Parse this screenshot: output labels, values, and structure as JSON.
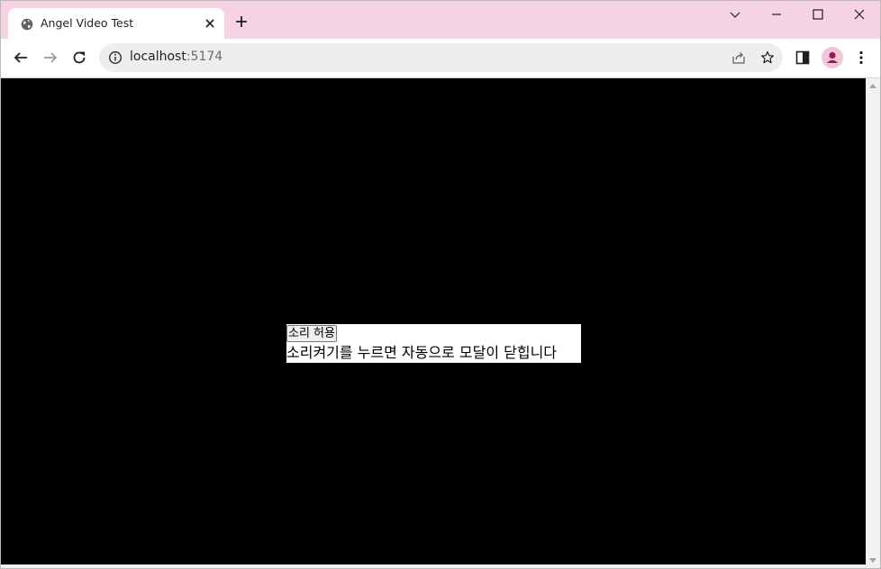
{
  "browser": {
    "tab": {
      "title": "Angel Video Test",
      "favicon": "globe-icon"
    },
    "address_bar": {
      "host": "localhost",
      "port": ":5174"
    },
    "colors": {
      "tab_strip": "#f6d3e2",
      "page_background": "#000000"
    }
  },
  "page": {
    "sound_allow_button": "소리 허용",
    "modal_message": "소리켜기를 누르면 자동으로 모달이 닫힙니다"
  }
}
